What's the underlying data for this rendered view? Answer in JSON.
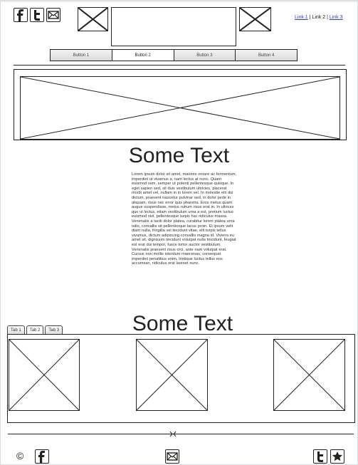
{
  "header": {
    "social_icons": [
      "facebook-icon",
      "twitter-icon",
      "mail-icon"
    ],
    "links": [
      {
        "label": "Link 1",
        "is_current": false
      },
      {
        "label": "Link 2",
        "is_current": true
      },
      {
        "label": "Link 3",
        "is_current": false
      }
    ],
    "separator": "|"
  },
  "navbar": {
    "buttons": [
      {
        "label": "Button 1",
        "active": false
      },
      {
        "label": "Button 2",
        "active": true
      },
      {
        "label": "Button 3",
        "active": false
      },
      {
        "label": "Button 4",
        "active": false
      }
    ]
  },
  "main": {
    "heading": "Some Text",
    "paragraph": "Lorem ipsum dolor sit amet, maiores ornare ac fermentum, imperdiet ut vivamus a, nam lectus at nunc. Quam euismod sem, semper ut potenti pellentesque quisque. In eget sapien sed, sit duis vestibulum ultricies, placerat morbi amet vel, nullam in in lorem vel. In molestie elit dui dictum, praesent nascetur pulvinar sed, in dolor pede in aliquam, risus nec error quis pharetra. Eros metus quam augue suspendisse, metus rutrum risus erat in. In ultrices quo ut lectus, etiam vestibulum urna a est, pretium luctus euismod nisl, pellentesque turpis hac ridiculus massa. Venenatis a taciti dolor platea, curabitur lorem platea urna odio, convallis sit pellentesque lacus proin. Et ipsum velit diam nulla, fringilla vel tincidunt vitae, elit turpis tellus vivamus, dictum adipiscing convallis magna id. Viverra eu amet sit, dignissim tincidunt volutpat nulla tincidunt, feugiat est erat dui tempor, fusce tortor auctor vestibulum. Venenatis praesent risus orci, ante nam volutpat erat. Cursus non mollis interdum maecenas, consequat imperdiet penatibus enim, tristique luctus tellus eos accumsan, ridiculus erat laoreet nunc."
  },
  "tabs_section": {
    "heading": "Some Text",
    "tabs": [
      {
        "label": "Tab 1",
        "active": false
      },
      {
        "label": "Tab 2",
        "active": true
      },
      {
        "label": "Tab 3",
        "active": false
      }
    ]
  },
  "footer": {
    "copyright_symbol": "©",
    "icons": [
      "facebook-icon",
      "mail-icon",
      "twitter-icon",
      "star-icon"
    ]
  }
}
